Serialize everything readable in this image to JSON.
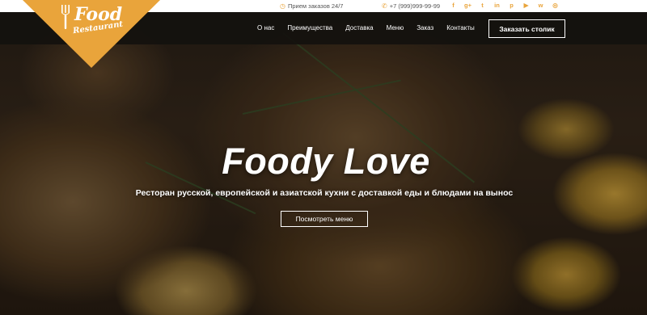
{
  "brand": {
    "name_main": "Food",
    "name_sub": "Restaurant",
    "accent_color": "#e9a43b"
  },
  "topbar": {
    "hours_icon": "clock-icon",
    "hours_text": "Прием заказов 24/7",
    "phone_icon": "phone-icon",
    "phone_text": "+7 (999)999-99-99",
    "socials": [
      {
        "name": "facebook-icon",
        "glyph": "f"
      },
      {
        "name": "google-plus-icon",
        "glyph": "g+"
      },
      {
        "name": "twitter-icon",
        "glyph": "t"
      },
      {
        "name": "linkedin-icon",
        "glyph": "in"
      },
      {
        "name": "pinterest-icon",
        "glyph": "p"
      },
      {
        "name": "youtube-icon",
        "glyph": "▶"
      },
      {
        "name": "whatsapp-icon",
        "glyph": "w"
      },
      {
        "name": "instagram-icon",
        "glyph": "◎"
      }
    ]
  },
  "nav": {
    "links": [
      "О нас",
      "Преимущества",
      "Доставка",
      "Меню",
      "Заказ",
      "Контакты"
    ],
    "book_button": "Заказать столик"
  },
  "hero": {
    "headline": "Foody Love",
    "subheadline": "Ресторан русской, европейской и азиатской кухни с доставкой еды и блюдами на вынос",
    "cta": "Посмотреть меню"
  }
}
